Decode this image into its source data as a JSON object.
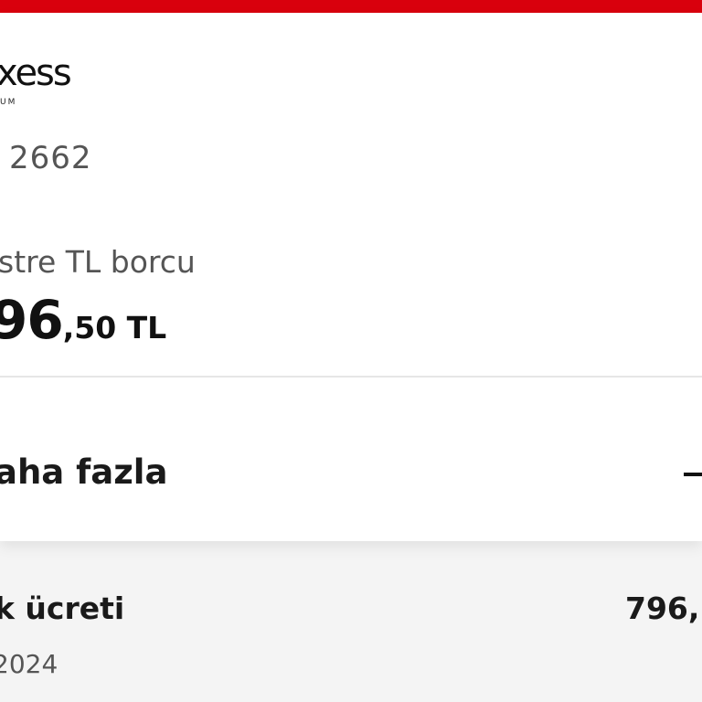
{
  "brand": {
    "logo_text": "xess",
    "sub_text": "UM"
  },
  "card": {
    "number": "2662"
  },
  "debt": {
    "label": "stre TL borcu",
    "amount_main": "96",
    "amount_decimal": ",50 TL"
  },
  "more": {
    "label": "aha fazla",
    "icon": "minus-icon"
  },
  "transaction": {
    "title": "k ücreti",
    "amount": "796,",
    "date": "2024"
  },
  "colors": {
    "accent": "#d9000d",
    "text_dark": "#1a1a1a",
    "text_muted": "#555555",
    "background": "#f4f4f4"
  }
}
